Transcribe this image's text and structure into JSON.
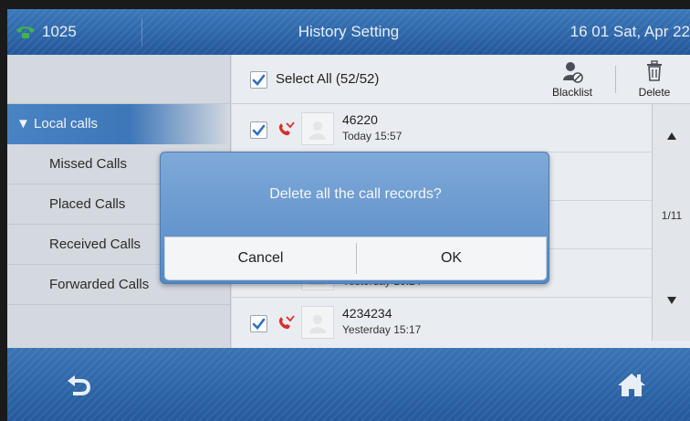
{
  "titlebar": {
    "extension": "1025",
    "title": "History Setting",
    "datetime": "16 01 Sat, Apr 22"
  },
  "sidebar": {
    "category": "▼ Local calls",
    "items": [
      {
        "label": "Missed Calls"
      },
      {
        "label": "Placed Calls"
      },
      {
        "label": "Received Calls"
      },
      {
        "label": "Forwarded Calls"
      }
    ]
  },
  "list": {
    "select_all_label": "Select All (52/52)",
    "toolbar": {
      "blacklist_label": "Blacklist",
      "delete_label": "Delete"
    },
    "rows": [
      {
        "number": "46220",
        "time": "Today 15:57"
      },
      {
        "number": "",
        "time": "Yesterday 16:24"
      },
      {
        "number": "4234234",
        "time": "Yesterday 15:17"
      }
    ],
    "page_indicator": "1/11"
  },
  "dialog": {
    "message": "Delete all the call records?",
    "cancel_label": "Cancel",
    "ok_label": "OK"
  },
  "icons": {
    "phone": "phone-icon",
    "missed_call": "missed-call-icon",
    "avatar": "contact-avatar-icon",
    "blacklist": "blacklist-icon",
    "delete": "trash-icon",
    "back": "back-icon",
    "home": "home-icon"
  },
  "colors": {
    "title_bar": "#2c65a6",
    "accent_green": "#3fb34f",
    "missed_red": "#d0312d",
    "check_blue": "#2f6fbf"
  }
}
